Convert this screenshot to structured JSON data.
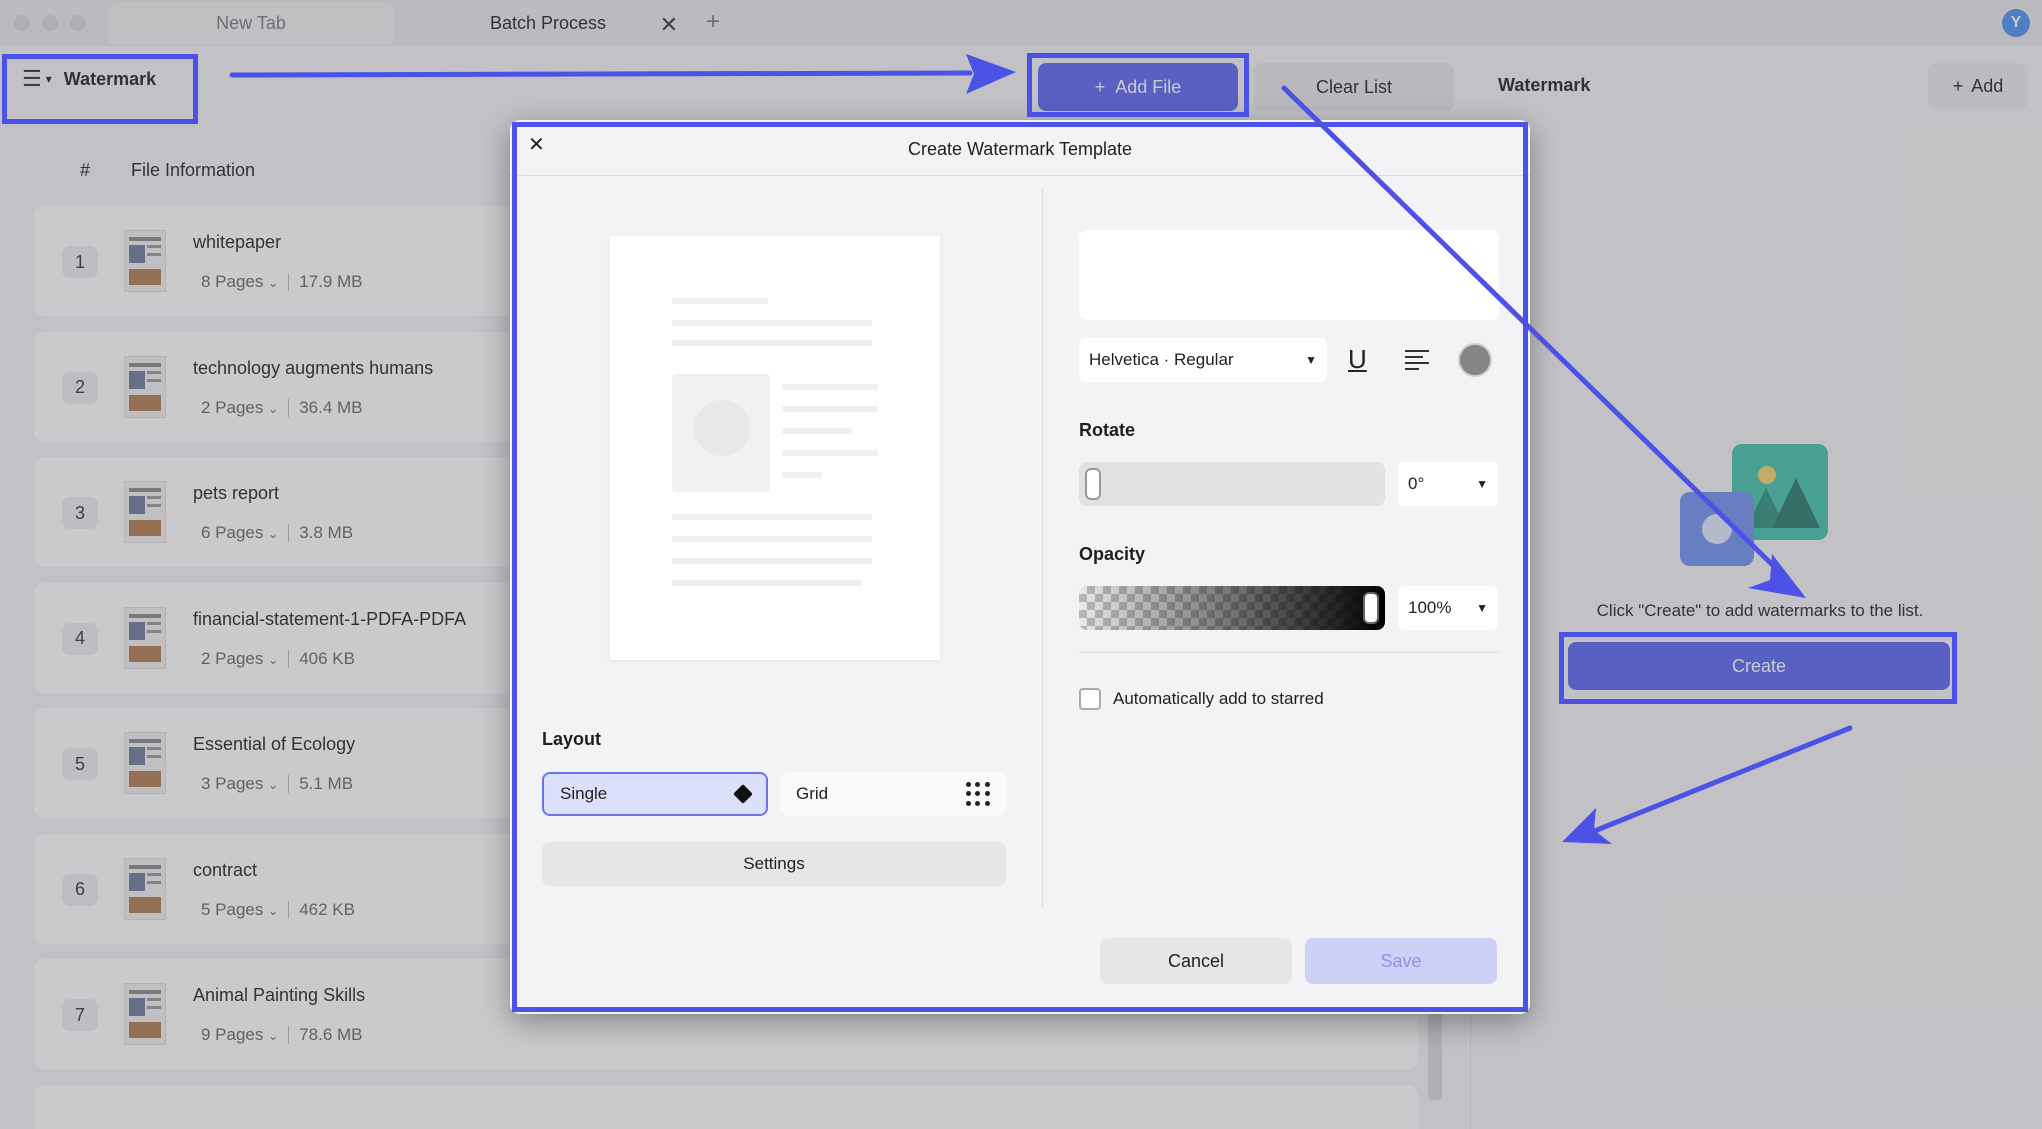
{
  "titlebar": {
    "tabs": [
      {
        "label": "New Tab"
      },
      {
        "label": "Batch Process"
      }
    ],
    "close_glyph": "✕",
    "plus_glyph": "+",
    "user_initial": "Y"
  },
  "toolbar": {
    "menu_label": "Watermark",
    "add_file_label": "Add File",
    "clear_list_label": "Clear List",
    "right_title": "Watermark",
    "add_label": "Add"
  },
  "list": {
    "header_num": "#",
    "header_info": "File Information",
    "files": [
      {
        "index": "1",
        "name": "whitepaper",
        "pages": "8 Pages",
        "size": "17.9 MB"
      },
      {
        "index": "2",
        "name": "technology augments humans",
        "pages": "2 Pages",
        "size": "36.4 MB"
      },
      {
        "index": "3",
        "name": "pets report",
        "pages": "6 Pages",
        "size": "3.8 MB"
      },
      {
        "index": "4",
        "name": "financial-statement-1-PDFA-PDFA",
        "pages": "2 Pages",
        "size": "406 KB"
      },
      {
        "index": "5",
        "name": "Essential of Ecology",
        "pages": "3 Pages",
        "size": "5.1 MB"
      },
      {
        "index": "6",
        "name": "contract",
        "pages": "5 Pages",
        "size": "462 KB"
      },
      {
        "index": "7",
        "name": "Animal Painting Skills",
        "pages": "9 Pages",
        "size": "78.6 MB"
      }
    ]
  },
  "right_panel": {
    "hint": "Click \"Create\" to add watermarks to the list.",
    "create_label": "Create"
  },
  "modal": {
    "title": "Create Watermark Template",
    "close_glyph": "✕",
    "layout_label": "Layout",
    "layout_single": "Single",
    "layout_grid": "Grid",
    "settings_label": "Settings",
    "font_value": "Helvetica · Regular",
    "underline_glyph": "U",
    "rotate_label": "Rotate",
    "rotate_value": "0°",
    "rotate_level": 0,
    "opacity_label": "Opacity",
    "opacity_value": "100%",
    "opacity_level": 1.0,
    "starred_label": "Automatically add to starred",
    "starred_checked": false,
    "cancel_label": "Cancel",
    "save_label": "Save",
    "watermark_color": "#858585"
  },
  "colors": {
    "accent": "#5865f2",
    "annotation": "#4c52e6"
  },
  "icons": {
    "menu": "hamburger-icon",
    "add_file": "plus-icon",
    "add": "plus-icon",
    "close": "close-icon",
    "underline": "underline-icon",
    "align": "align-left-icon",
    "color": "color-swatch-icon",
    "single": "diamond-dot-icon",
    "grid": "dot-grid-icon",
    "illustration": "image-photo-icon"
  }
}
